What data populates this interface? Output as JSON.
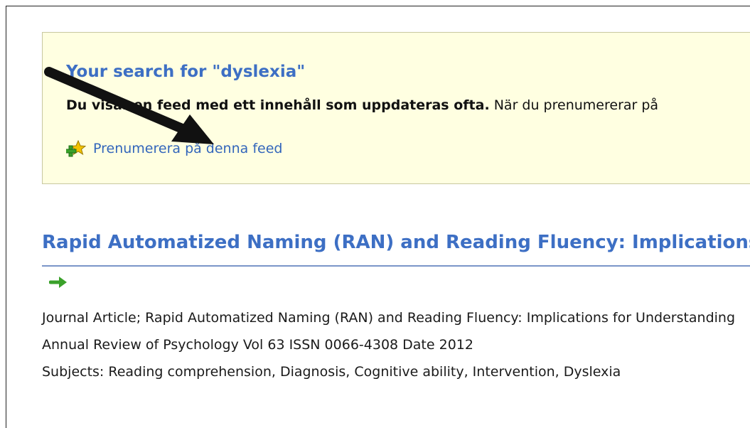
{
  "feed": {
    "title": "Your search for \"dyslexia\"",
    "desc_bold": "Du visar en feed med ett innehåll som uppdateras ofta.",
    "desc_rest": " När du prenumererar på",
    "subscribe_label": "Prenumerera på denna feed"
  },
  "article": {
    "title": "Rapid Automatized Naming (RAN) and Reading Fluency: Implications for Understanding and Treatment of Reading Disabilities",
    "line1": "Journal Article; Rapid Automatized Naming (RAN) and Reading Fluency: Implications for Understanding",
    "line2": "Annual Review of Psychology Vol 63 ISSN 0066-4308 Date 2012",
    "line3": "Subjects: Reading comprehension, Diagnosis, Cognitive ability, Intervention, Dyslexia"
  },
  "icons": {
    "subscribe": "feed-star-plus-icon",
    "article_go": "green-arrow-right-icon",
    "annotation": "black-arrow-annotation"
  },
  "colors": {
    "link": "#3366bb",
    "title": "#3d6fc4",
    "feed_background": "#ffffe1",
    "rule": "#7b95c9",
    "icon_green": "#3aa12a",
    "icon_star": "#f2c200"
  }
}
